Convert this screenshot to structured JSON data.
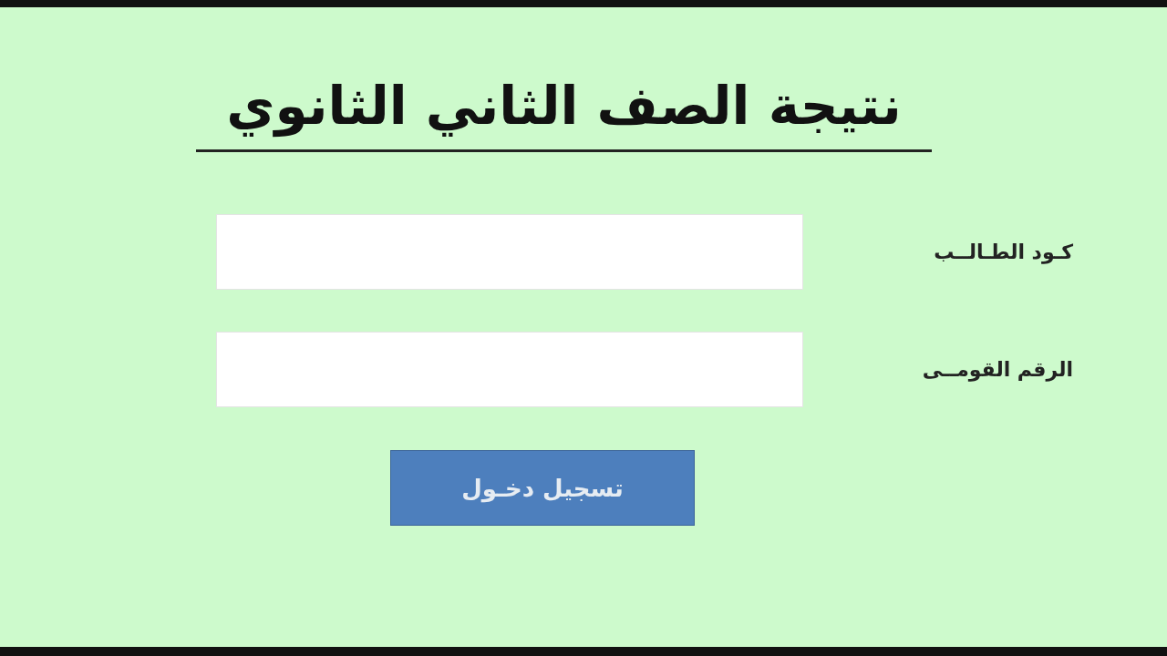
{
  "title": "نتيجة الصف الثاني الثانوي",
  "fields": [
    {
      "label": "كـود الطـالــب"
    },
    {
      "label": "الرقم القومــى"
    }
  ],
  "button": "تسجيل دخـول"
}
